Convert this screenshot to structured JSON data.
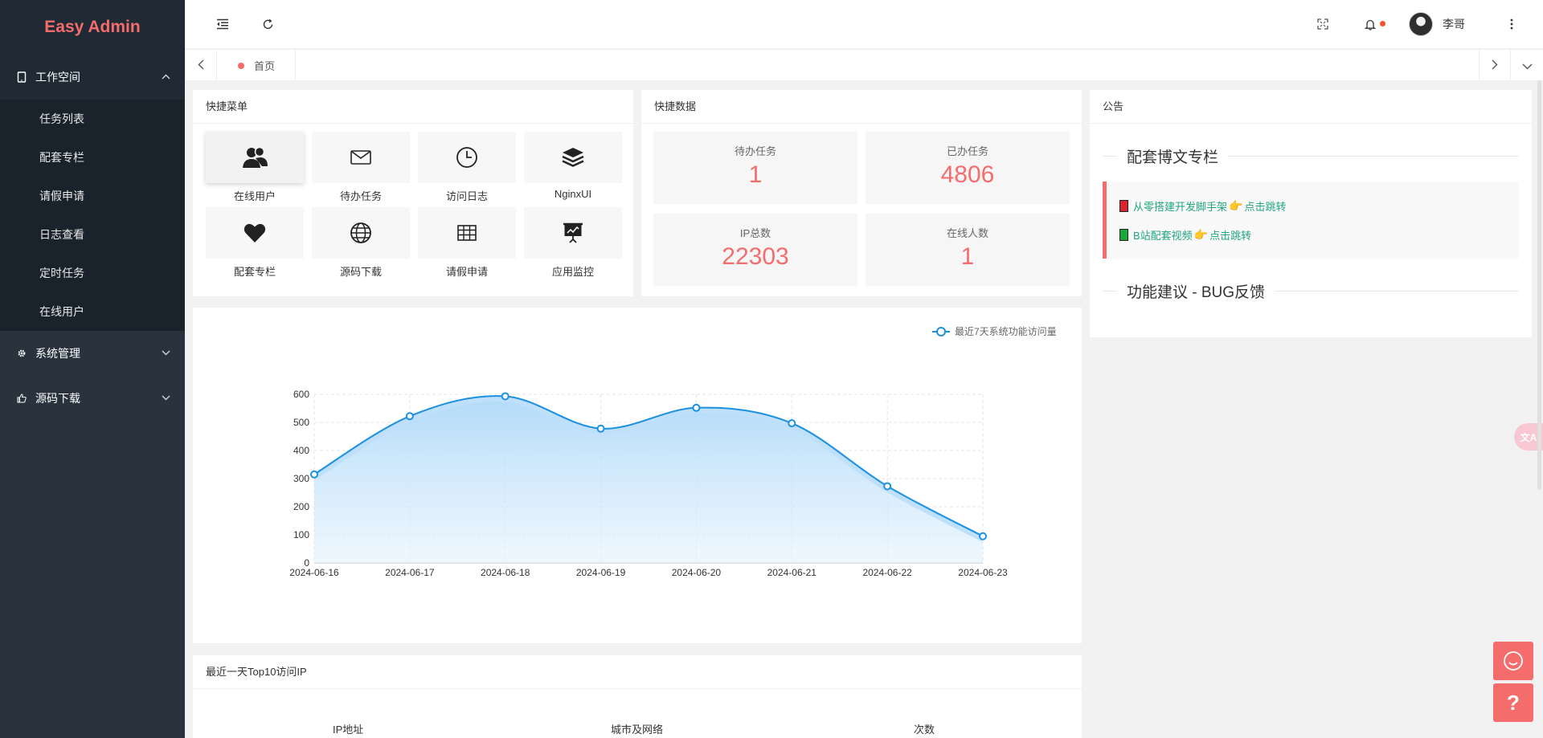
{
  "brand": {
    "title": "Easy Admin"
  },
  "sidebar": {
    "workspace": {
      "label": "工作空间",
      "icon": "tablet-icon"
    },
    "items": [
      {
        "label": "任务列表"
      },
      {
        "label": "配套专栏"
      },
      {
        "label": "请假申请"
      },
      {
        "label": "日志查看"
      },
      {
        "label": "定时任务"
      },
      {
        "label": "在线用户"
      }
    ],
    "system": {
      "label": "系统管理",
      "icon": "gear-icon"
    },
    "source": {
      "label": "源码下载",
      "icon": "thumbs-up-icon"
    }
  },
  "header": {
    "user_name": "李哥"
  },
  "tabs": {
    "home": "首页"
  },
  "quick_menu": {
    "title": "快捷菜单",
    "items": [
      {
        "label": "在线用户",
        "icon": "users-icon"
      },
      {
        "label": "待办任务",
        "icon": "mail-icon"
      },
      {
        "label": "访问日志",
        "icon": "clock-icon"
      },
      {
        "label": "NginxUI",
        "icon": "layers-icon"
      },
      {
        "label": "配套专栏",
        "icon": "heart-icon"
      },
      {
        "label": "源码下载",
        "icon": "globe-icon"
      },
      {
        "label": "请假申请",
        "icon": "table-icon"
      },
      {
        "label": "应用监控",
        "icon": "monitor-chart-icon"
      }
    ]
  },
  "quick_data": {
    "title": "快捷数据",
    "cards": [
      {
        "label": "待办任务",
        "value": "1"
      },
      {
        "label": "已办任务",
        "value": "4806"
      },
      {
        "label": "IP总数",
        "value": "22303"
      },
      {
        "label": "在线人数",
        "value": "1"
      }
    ]
  },
  "notice": {
    "title": "公告",
    "section1": "配套博文专栏",
    "links": [
      {
        "text": "从零搭建开发脚手架",
        "action": "点击跳转",
        "book_color": "#d9232d"
      },
      {
        "text": "B站配套视频",
        "action": "点击跳转",
        "book_color": "#1aa83a"
      }
    ],
    "section2": "功能建议 - BUG反馈"
  },
  "chart_data": {
    "type": "area",
    "title": "",
    "xlabel": "",
    "ylabel": "",
    "x": [
      "2024-06-16",
      "2024-06-17",
      "2024-06-18",
      "2024-06-19",
      "2024-06-20",
      "2024-06-21",
      "2024-06-22",
      "2024-06-23"
    ],
    "series": [
      {
        "name": "最近7天系统功能访问量",
        "values": [
          315,
          522,
          593,
          478,
          552,
          497,
          273,
          95
        ]
      }
    ],
    "y_ticks": [
      0,
      100,
      200,
      300,
      400,
      500,
      600
    ],
    "ylim": [
      0,
      600
    ],
    "grid": true,
    "smooth": true,
    "legend": "top-right",
    "color": "#1e90e0"
  },
  "top_ip": {
    "title": "最近一天Top10访问IP",
    "columns": [
      "IP地址",
      "城市及网络",
      "次数"
    ]
  },
  "colors": {
    "accent": "#f56c6c",
    "sidebar": "#28333e",
    "link": "#20a57e"
  }
}
